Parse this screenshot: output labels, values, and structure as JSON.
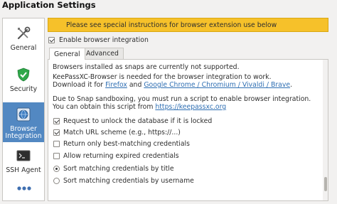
{
  "app": {
    "title": "Application Settings"
  },
  "sidebar": {
    "items": [
      {
        "label": "General",
        "icon": "wrench-screwdriver-icon"
      },
      {
        "label": "Security",
        "icon": "shield-icon"
      },
      {
        "label": "Browser\nIntegration",
        "label_line1": "Browser",
        "label_line2": "Integration",
        "icon": "browser-globe-icon",
        "active": true
      },
      {
        "label": "SSH Agent",
        "icon": "terminal-icon"
      }
    ],
    "more_icon": "more-dots-icon",
    "active_color": "#5288c2"
  },
  "banner": {
    "text": "Please see special instructions for browser extension use below",
    "color": "#f6c12a"
  },
  "enable": {
    "label": "Enable browser integration",
    "checked": true
  },
  "tabs": [
    {
      "label": "General",
      "active": true
    },
    {
      "label": "Advanced",
      "active": false
    }
  ],
  "general": {
    "snap_notice": "Browsers installed as snaps are currently not supported.",
    "needed_line": "KeePassXC-Browser is needed for the browser integration to work.",
    "download_prefix": "Download it for",
    "firefox_link": "Firefox",
    "and_text": "and",
    "chromium_link": "Google Chrome / Chromium / Vivaldi / Brave",
    "period": ".",
    "sandbox_line": "Due to Snap sandboxing, you must run a script to enable browser integration.",
    "script_prefix": "You can obtain this script from",
    "script_link": "https://keepassxc.org",
    "options": [
      {
        "label": "Request to unlock the database if it is locked",
        "type": "checkbox",
        "checked": true
      },
      {
        "label": "Match URL scheme (e.g., https://...)",
        "type": "checkbox",
        "checked": true
      },
      {
        "label": "Return only best-matching credentials",
        "type": "checkbox",
        "checked": false
      },
      {
        "label": "Allow returning expired credentials",
        "type": "checkbox",
        "checked": false
      },
      {
        "label": "Sort matching credentials by title",
        "type": "radio",
        "checked": true
      },
      {
        "label": "Sort matching credentials by username",
        "type": "radio",
        "checked": false
      }
    ]
  }
}
